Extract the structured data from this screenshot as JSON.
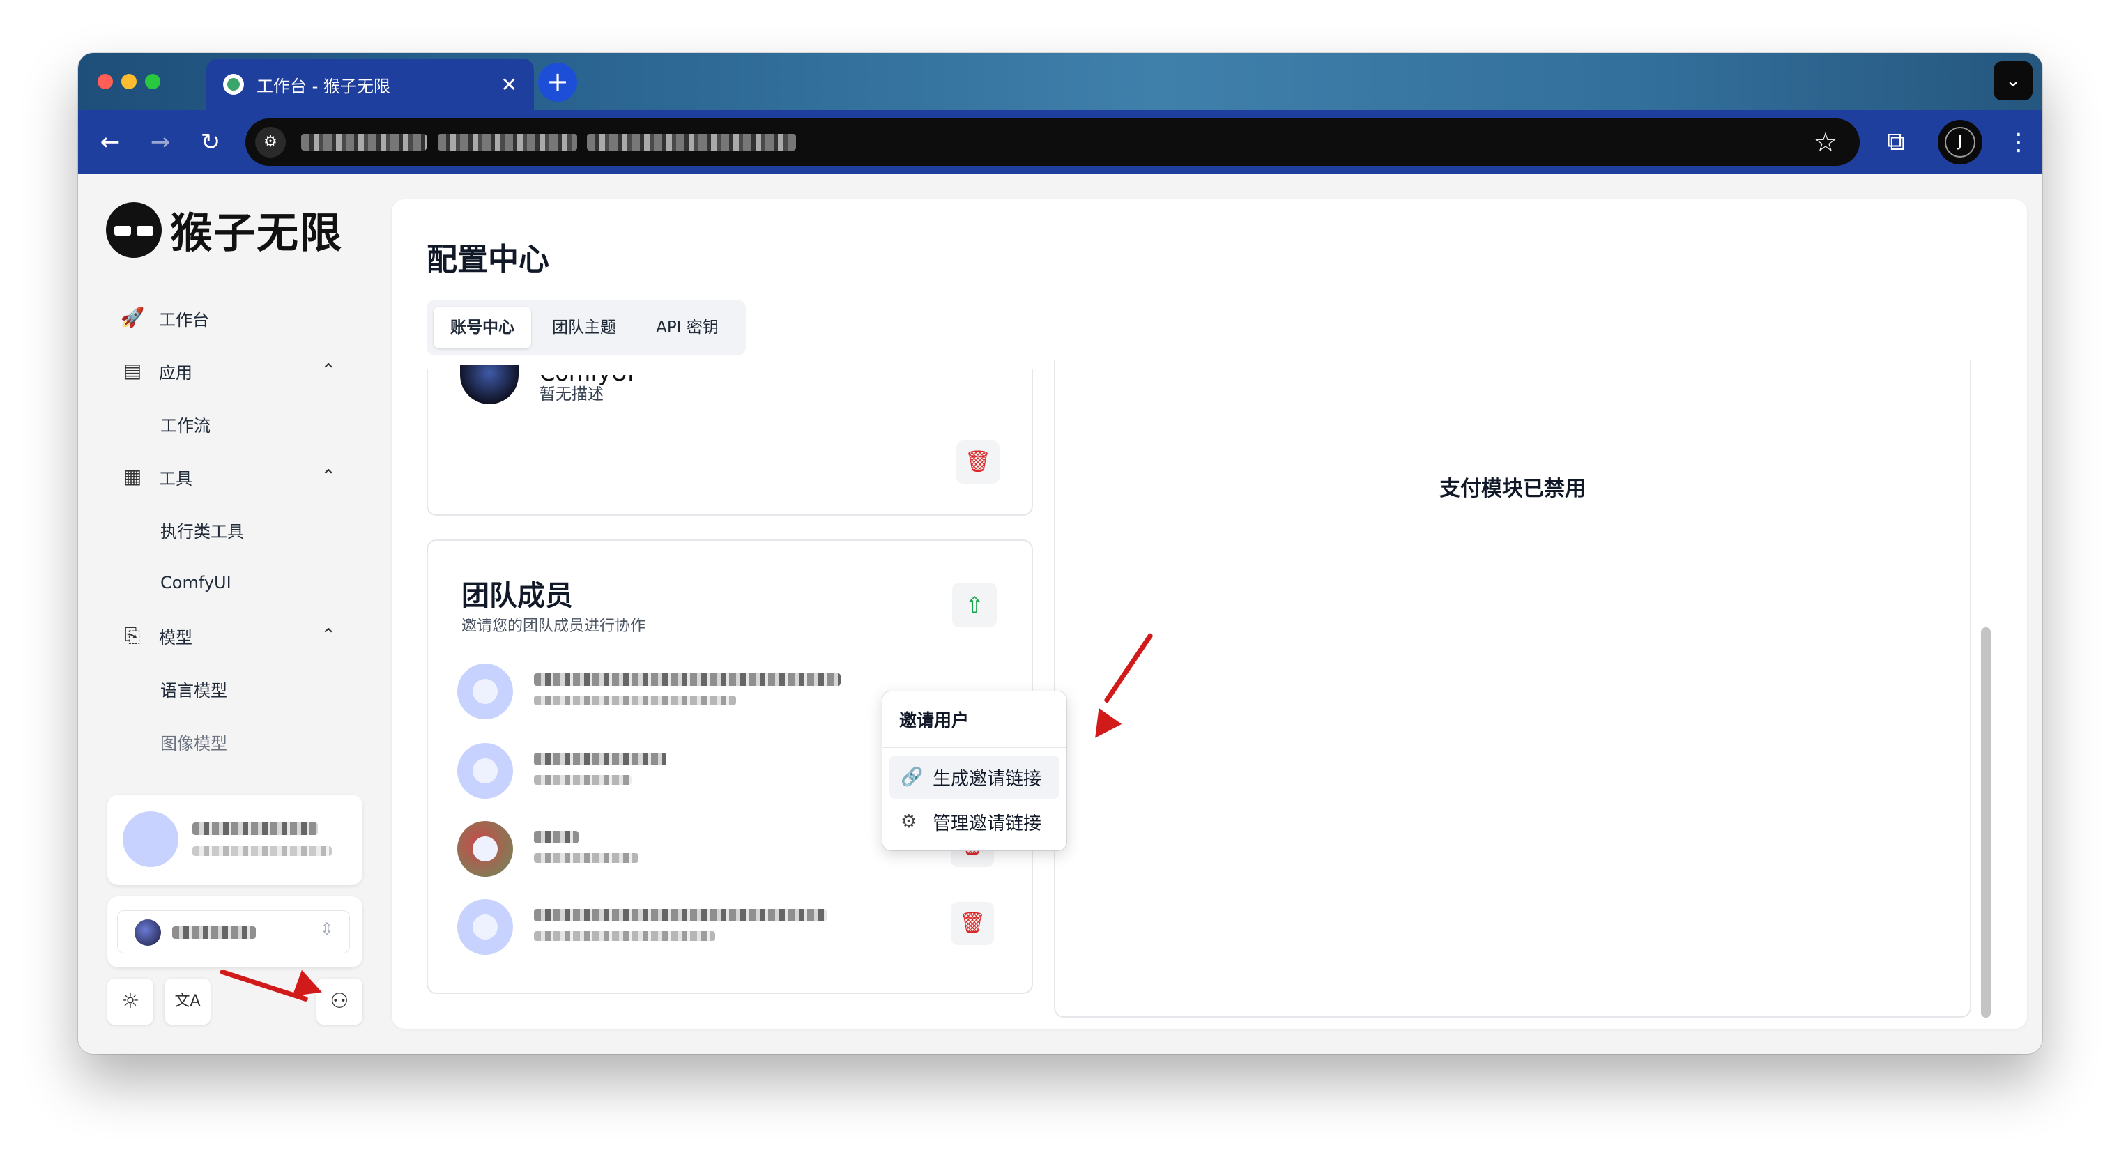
{
  "browser": {
    "tab_title": "工作台 - 猴子无限",
    "tab_close": "✕",
    "new_tab": "+",
    "tab_menu": "⌄",
    "profile_initial": "J",
    "controls": {
      "back": "←",
      "forward": "→",
      "reload": "↻",
      "site_info": "⚙",
      "bookmark": "☆",
      "extensions": "⧉",
      "menu": "⋮"
    }
  },
  "brand": {
    "name": "猴子无限"
  },
  "sidebar": {
    "items": [
      {
        "label": "工作台",
        "icon": "rocket-icon",
        "glyph": "🚀"
      },
      {
        "label": "应用",
        "icon": "server-icon",
        "glyph": "▤",
        "chevron": "⌃"
      },
      {
        "label": "工作流",
        "sub": true
      },
      {
        "label": "工具",
        "icon": "calculator-icon",
        "glyph": "▦",
        "chevron": "⌃"
      },
      {
        "label": "执行类工具",
        "sub": true
      },
      {
        "label": "ComfyUI",
        "sub": true
      },
      {
        "label": "模型",
        "icon": "file-model-icon",
        "glyph": "⎘",
        "chevron": "⌃"
      },
      {
        "label": "语言模型",
        "sub": true
      },
      {
        "label": "图像模型",
        "sub": true
      }
    ],
    "theme_glyph": "☼",
    "language_glyph": "文A",
    "account_glyph": "⚇",
    "team_selector_glyph": "⇳"
  },
  "main": {
    "title": "配置中心",
    "tabs": [
      {
        "label": "账号中心",
        "active": true
      },
      {
        "label": "团队主题"
      },
      {
        "label": "API 密钥"
      }
    ],
    "team_card": {
      "name": "ComfyUI",
      "description": "暂无描述",
      "trash_glyph": "🗑"
    },
    "members": {
      "title": "团队成员",
      "subtitle": "邀请您的团队成员进行协作",
      "upload_glyph": "⇧",
      "trash_glyph": "🗑"
    },
    "invite_menu": {
      "title": "邀请用户",
      "items": [
        {
          "label": "生成邀请链接",
          "glyph": "🔗"
        },
        {
          "label": "管理邀请链接",
          "glyph": "⚙"
        }
      ]
    },
    "payment": {
      "message": "支付模块已禁用"
    }
  },
  "colors": {
    "accent": "#1f3f9e",
    "danger": "#dc2626",
    "success": "#16a34a",
    "annotation": "#d11a1a"
  }
}
